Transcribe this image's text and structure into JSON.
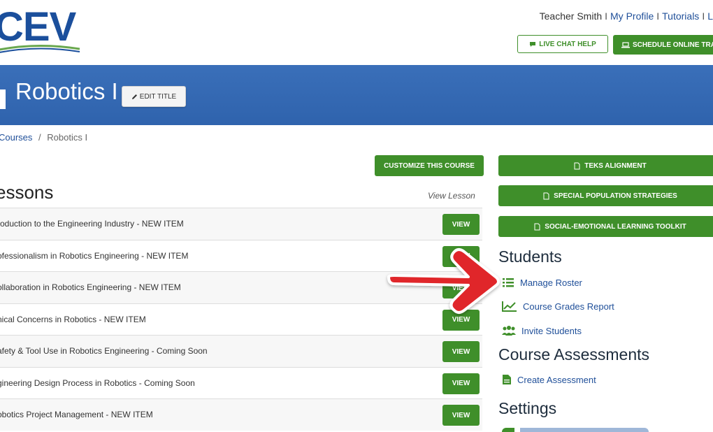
{
  "header": {
    "logo_text": "CEV",
    "user_name": "Teacher Smith",
    "links": [
      "My Profile",
      "Tutorials",
      "L"
    ],
    "live_chat_label": "LIVE CHAT HELP",
    "schedule_label": "SCHEDULE ONLINE TRA"
  },
  "banner": {
    "title": "Robotics I",
    "edit_label": "EDIT TITLE"
  },
  "breadcrumb": {
    "courses": "Courses",
    "separator": "/",
    "current": "Robotics I"
  },
  "lessons": {
    "heading": "essons",
    "customize_label": "CUSTOMIZE THIS COURSE",
    "view_lesson_label": "View Lesson",
    "view_button_label": "VIEW",
    "items": [
      "roduction to the Engineering Industry - NEW ITEM",
      "ofessionalism in Robotics Engineering - NEW ITEM",
      "ollaboration in Robotics Engineering - NEW ITEM",
      "nical Concerns in Robotics - NEW ITEM",
      "afety & Tool Use in Robotics Engineering - Coming Soon",
      "gineering Design Process in Robotics - Coming Soon",
      "obotics Project Management - NEW ITEM"
    ]
  },
  "sidebar": {
    "buttons": [
      "TEKS ALIGNMENT",
      "SPECIAL POPULATION STRATEGIES",
      "SOCIAL-EMOTIONAL LEARNING TOOLKIT"
    ],
    "students_heading": "Students",
    "manage_roster": "Manage Roster",
    "grades_report": "Course Grades Report",
    "invite_students": "Invite Students",
    "assessments_heading": "Course Assessments",
    "create_assessment": "Create Assessment",
    "settings_heading": "Settings"
  },
  "colors": {
    "brand_blue": "#2f63ad",
    "action_green": "#3f8f2a",
    "link_blue": "#1f4f99",
    "annotation_red": "#e0262a"
  }
}
